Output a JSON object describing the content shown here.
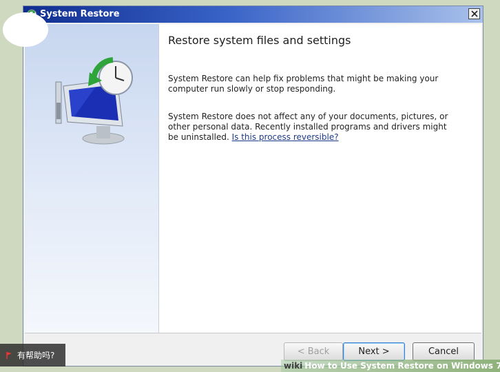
{
  "window": {
    "title": "System Restore",
    "icon": "system-restore-icon"
  },
  "main": {
    "heading": "Restore system files and settings",
    "paragraph1": "System Restore can help fix problems that might be making your computer run slowly or stop responding.",
    "paragraph2_text": "System Restore does not affect any of your documents, pictures, or other personal data. Recently installed programs and drivers might be uninstalled.",
    "paragraph2_link": "Is this process reversible?"
  },
  "buttons": {
    "back": "< Back",
    "next": "Next >",
    "cancel": "Cancel"
  },
  "overlay": {
    "help_badge": "有帮助吗?",
    "watermark_brand": "wiki",
    "watermark_text": "How to Use System Restore on Windows 7"
  },
  "colors": {
    "title_bar": "#0f2d8f",
    "link": "#1e3a8a",
    "background": "#cfd9c0"
  }
}
